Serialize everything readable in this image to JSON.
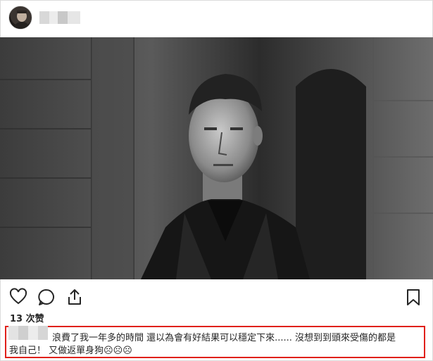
{
  "post": {
    "username": "",
    "likes_text": "13 次赞",
    "caption_line1": "浪費了我一年多的時間 還以為會有好結果可以穩定下來...... 沒想到到頭來受傷的都是",
    "caption_line2": "我自己！ 又做返單身狗☹☹☹"
  },
  "icons": {
    "avatar": "avatar",
    "like": "heart-icon",
    "comment": "comment-icon",
    "share": "share-icon",
    "save": "bookmark-icon"
  },
  "colors": {
    "highlight": "#e0201a",
    "text": "#262626"
  }
}
